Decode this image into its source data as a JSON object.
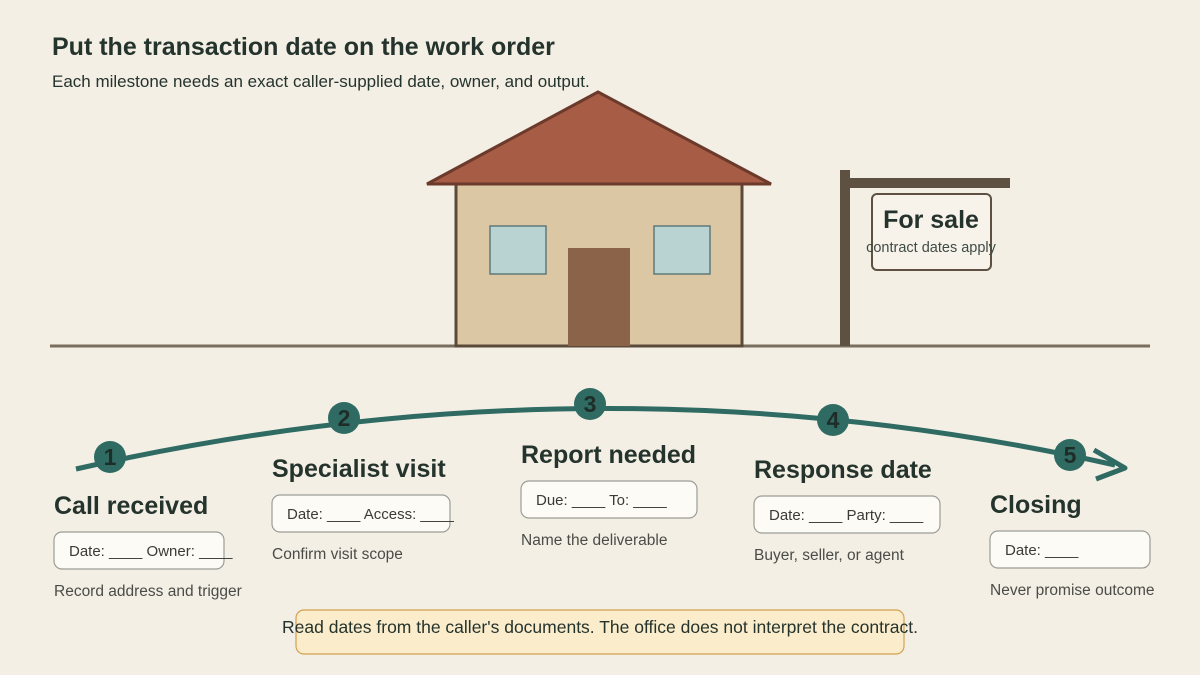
{
  "header": {
    "title": "Put the transaction date on the work order",
    "subtitle": "Each milestone needs an exact caller-supplied date, owner, and output."
  },
  "sign": {
    "title": "For sale",
    "subtitle": "contract dates apply"
  },
  "steps": [
    {
      "number": "1",
      "title": "Call received",
      "fields": "Date: ____ Owner: ____",
      "note": "Record address and trigger"
    },
    {
      "number": "2",
      "title": "Specialist visit",
      "fields": "Date: ____ Access: ____",
      "note": "Confirm visit scope"
    },
    {
      "number": "3",
      "title": "Report needed",
      "fields": "Due: ____ To: ____",
      "note": "Name the deliverable"
    },
    {
      "number": "4",
      "title": "Response date",
      "fields": "Date: ____ Party: ____",
      "note": "Buyer, seller, or agent"
    },
    {
      "number": "5",
      "title": "Closing",
      "fields": "Date: ____",
      "note": "Never promise outcome"
    }
  ],
  "footer": {
    "note": "Read dates from the caller's documents. The office does not interpret the contract."
  },
  "colors": {
    "background": "#f3efe5",
    "teal": "#2f6b63",
    "roof": "#a65c45",
    "wall": "#dcc7a4",
    "door": "#8a6349",
    "window": "#b9d3d2",
    "ink": "#25332d",
    "note_fill": "#fbeccb",
    "note_stroke": "#d4a14f"
  }
}
